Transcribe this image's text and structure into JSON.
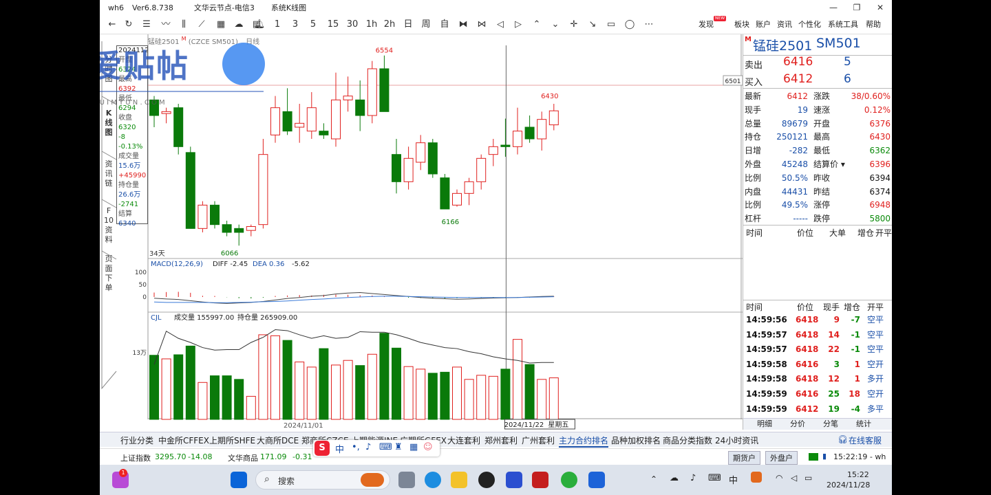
{
  "window": {
    "app": "wh6",
    "version": "Ver6.8.738",
    "server": "文华云节点-电信3",
    "view": "系统K线图"
  },
  "toolbar": {
    "periods": [
      "1",
      "3",
      "5",
      "15",
      "30",
      "1h",
      "2h",
      "日",
      "周",
      "自"
    ],
    "menu": [
      "发现",
      "板块",
      "账户",
      "资讯",
      "个性化",
      "系统工具",
      "帮助"
    ],
    "new_badge": "NEW"
  },
  "watermark": {
    "title": "我爱贴帖",
    "site": "W W W . Z U I M Y U N . C O M"
  },
  "left_tabs": [
    "分时图",
    "K线图",
    "资讯链",
    "F10资料",
    "页面下单"
  ],
  "chart_header": {
    "name": "锰硅2501",
    "code": "(CZCE SM501)",
    "period": "日线"
  },
  "info_panel": {
    "date": "20241122",
    "items": [
      {
        "label": "开盘",
        "value": "6324",
        "color": "green"
      },
      {
        "label": "最高",
        "value": "6392",
        "color": "red"
      },
      {
        "label": "最低",
        "value": "6294",
        "color": "green"
      },
      {
        "label": "收盘",
        "value": "6320",
        "color": "green"
      },
      {
        "label": "",
        "value": "-8",
        "color": "green"
      },
      {
        "label": "",
        "value": "-0.13%",
        "color": "green"
      },
      {
        "label": "成交量",
        "value": "15.6万",
        "color": "blue"
      },
      {
        "label": "",
        "value": "+45990",
        "color": "red"
      },
      {
        "label": "持仓量",
        "value": "26.6万",
        "color": "blue"
      },
      {
        "label": "",
        "value": "-2741",
        "color": "green"
      },
      {
        "label": "结算",
        "value": "6340",
        "color": "blue"
      }
    ]
  },
  "chart_data": {
    "type": "candlestick",
    "symbol": "锰硅2501",
    "candles": [
      {
        "o": 6440,
        "h": 6450,
        "l": 6370,
        "c": 6400
      },
      {
        "o": 6405,
        "h": 6420,
        "l": 6380,
        "c": 6410
      },
      {
        "o": 6420,
        "h": 6430,
        "l": 6300,
        "c": 6320
      },
      {
        "o": 6305,
        "h": 6320,
        "l": 6110,
        "c": 6110
      },
      {
        "o": 6110,
        "h": 6180,
        "l": 6100,
        "c": 6170
      },
      {
        "o": 6170,
        "h": 6180,
        "l": 6110,
        "c": 6120
      },
      {
        "o": 6120,
        "h": 6130,
        "l": 6090,
        "c": 6100
      },
      {
        "o": 6110,
        "h": 6120,
        "l": 6066,
        "c": 6100
      },
      {
        "o": 6105,
        "h": 6120,
        "l": 6090,
        "c": 6115
      },
      {
        "o": 6120,
        "h": 6340,
        "l": 6110,
        "c": 6300
      },
      {
        "o": 6350,
        "h": 6450,
        "l": 6330,
        "c": 6420
      },
      {
        "o": 6410,
        "h": 6470,
        "l": 6350,
        "c": 6360
      },
      {
        "o": 6370,
        "h": 6430,
        "l": 6330,
        "c": 6380
      },
      {
        "o": 6360,
        "h": 6460,
        "l": 6340,
        "c": 6420
      },
      {
        "o": 6360,
        "h": 6380,
        "l": 6340,
        "c": 6350
      },
      {
        "o": 6340,
        "h": 6510,
        "l": 6320,
        "c": 6440
      },
      {
        "o": 6440,
        "h": 6500,
        "l": 6410,
        "c": 6450
      },
      {
        "o": 6440,
        "h": 6490,
        "l": 6360,
        "c": 6400
      },
      {
        "o": 6400,
        "h": 6540,
        "l": 6380,
        "c": 6520
      },
      {
        "o": 6520,
        "h": 6554,
        "l": 6410,
        "c": 6410
      },
      {
        "o": 6300,
        "h": 6340,
        "l": 6200,
        "c": 6230
      },
      {
        "o": 6230,
        "h": 6320,
        "l": 6210,
        "c": 6290
      },
      {
        "o": 6280,
        "h": 6350,
        "l": 6260,
        "c": 6330
      },
      {
        "o": 6330,
        "h": 6340,
        "l": 6240,
        "c": 6250
      },
      {
        "o": 6240,
        "h": 6250,
        "l": 6160,
        "c": 6160
      },
      {
        "o": 6170,
        "h": 6210,
        "l": 6166,
        "c": 6200
      },
      {
        "o": 6200,
        "h": 6240,
        "l": 6170,
        "c": 6230
      },
      {
        "o": 6230,
        "h": 6300,
        "l": 6210,
        "c": 6290
      },
      {
        "o": 6300,
        "h": 6340,
        "l": 6270,
        "c": 6320
      },
      {
        "o": 6324,
        "h": 6392,
        "l": 6294,
        "c": 6320
      },
      {
        "o": 6320,
        "h": 6420,
        "l": 6300,
        "c": 6360
      },
      {
        "o": 6370,
        "h": 6400,
        "l": 6330,
        "c": 6340
      },
      {
        "o": 6340,
        "h": 6410,
        "l": 6310,
        "c": 6390
      },
      {
        "o": 6376,
        "h": 6430,
        "l": 6362,
        "c": 6412
      }
    ],
    "volumes": [
      12.5,
      11.8,
      12.6,
      14.3,
      7.2,
      8.5,
      8.5,
      7.8,
      4.5,
      16.5,
      16.3,
      15.4,
      11.2,
      10.2,
      13.8,
      10.6,
      11.5,
      10.5,
      12.7,
      16.8,
      13.9,
      10.3,
      9.8,
      9.0,
      9.2,
      10.2,
      7.8,
      8.6,
      8.4,
      9.8,
      15.6,
      10.7,
      7.8,
      8.1
    ],
    "volume_line": [
      10.7,
      17.2,
      15.8,
      15.0,
      14.0,
      13.5,
      13.6,
      13.6,
      15.0,
      16.0,
      17.5,
      17.3,
      16.5,
      15.8,
      16.3,
      15.8,
      16.0,
      17.1,
      17.0,
      17.0,
      16.5,
      15.8,
      15.0,
      14.5,
      14.0,
      13.8,
      13.2,
      12.8,
      12.2,
      11.8,
      11.5,
      11.0,
      11.1,
      11.1
    ],
    "macd_hist": [
      18,
      20,
      21,
      17,
      5,
      4,
      -1,
      -5,
      -6,
      -3,
      4,
      6,
      8,
      6,
      9,
      10,
      9,
      7,
      6,
      3,
      0,
      -3,
      -4,
      -6,
      -7,
      -5,
      -3,
      -3,
      -2,
      -2,
      -1,
      -3,
      1,
      2
    ],
    "diff_line": [
      -5,
      -8,
      -10,
      -15,
      -20,
      -24,
      -26,
      -24,
      -22,
      -18,
      -12,
      -6,
      -2,
      3,
      6,
      12,
      16,
      18,
      14,
      10,
      6,
      2,
      -2,
      -5,
      -7,
      -9,
      -8,
      -6,
      -4,
      -3,
      -2,
      0,
      2,
      3
    ],
    "dea_line": [
      -20,
      -22,
      -22,
      -22,
      -22,
      -23,
      -23,
      -22,
      -21,
      -19,
      -18,
      -16,
      -13,
      -10,
      -8,
      -5,
      -2,
      0,
      2,
      3,
      3,
      2,
      1,
      0,
      -1,
      -2,
      -2,
      -2,
      -2,
      -2,
      -2,
      -1,
      0,
      1
    ],
    "annotations": {
      "high": "6554",
      "low_left": "6066",
      "low_right": "6166",
      "recent_high": "6430",
      "current_line": "6501",
      "days": "34天"
    },
    "macd_header": {
      "label": "MACD(12,26,9)",
      "diff": "DIFF -2.45",
      "dea": "DEA 0.36",
      "macd": "-5.62"
    },
    "macd_ticks": [
      "100",
      "50",
      "0"
    ],
    "cjl_header": {
      "label": "CJL",
      "volume": "成交量 155997.00",
      "oi": "持仓量 265909.00"
    },
    "volume_tick": "13万",
    "x_labels": [
      "2024/11/01",
      "2024/11/22",
      "星期五"
    ],
    "price_range": [
      6040,
      6580
    ],
    "volume_max": 18.5
  },
  "quote": {
    "flag": "M",
    "name": "锰硅2501",
    "code": "SM501",
    "ask": {
      "label": "卖出",
      "price": "6416",
      "qty": "5"
    },
    "bid": {
      "label": "买入",
      "price": "6412",
      "qty": "6"
    },
    "rows": [
      {
        "l1": "最新",
        "v1": "6412",
        "c1": "red",
        "l2": "涨跌",
        "v2": "38/0.60%",
        "c2": "red"
      },
      {
        "l1": "现手",
        "v1": "19",
        "c1": "blue",
        "l2": "速涨",
        "v2": "0.12%",
        "c2": "red"
      },
      {
        "l1": "总量",
        "v1": "89679",
        "c1": "blue",
        "l2": "开盘",
        "v2": "6376",
        "c2": "red"
      },
      {
        "l1": "持仓",
        "v1": "250121",
        "c1": "blue",
        "l2": "最高",
        "v2": "6430",
        "c2": "red"
      },
      {
        "l1": "日增",
        "v1": "-282",
        "c1": "blue",
        "l2": "最低",
        "v2": "6362",
        "c2": "green"
      },
      {
        "l1": "外盘",
        "v1": "45248",
        "c1": "blue",
        "l2": "结算价",
        "v2": "6396",
        "c2": "red"
      },
      {
        "l1": "比例",
        "v1": "50.5%",
        "c1": "blue",
        "l2": "昨收",
        "v2": "6394",
        "c2": "dark"
      },
      {
        "l1": "内盘",
        "v1": "44431",
        "c1": "blue",
        "l2": "昨结",
        "v2": "6374",
        "c2": "dark"
      },
      {
        "l1": "比例",
        "v1": "49.5%",
        "c1": "blue",
        "l2": "涨停",
        "v2": "6948",
        "c2": "red"
      },
      {
        "l1": "杠杆",
        "v1": "-----",
        "c1": "blue",
        "l2": "跌停",
        "v2": "5800",
        "c2": "green"
      }
    ],
    "big_order_headers": [
      "时间",
      "价位",
      "大单",
      "增仓",
      "开平"
    ],
    "tick_headers": [
      "时间",
      "价位",
      "现手",
      "增仓",
      "开平"
    ],
    "ticks": [
      {
        "time": "14:59:56",
        "price": "6418",
        "qty": "9",
        "qc": "red",
        "oi": "-7",
        "oc": "green",
        "type": "空平"
      },
      {
        "time": "14:59:57",
        "price": "6418",
        "qty": "14",
        "qc": "red",
        "oi": "-1",
        "oc": "green",
        "type": "空平"
      },
      {
        "time": "14:59:57",
        "price": "6418",
        "qty": "22",
        "qc": "red",
        "oi": "-1",
        "oc": "green",
        "type": "空平"
      },
      {
        "time": "14:59:58",
        "price": "6416",
        "qty": "3",
        "qc": "green",
        "oi": "1",
        "oc": "red",
        "type": "空开"
      },
      {
        "time": "14:59:58",
        "price": "6418",
        "qty": "12",
        "qc": "red",
        "oi": "1",
        "oc": "red",
        "type": "多开"
      },
      {
        "time": "14:59:59",
        "price": "6416",
        "qty": "25",
        "qc": "green",
        "oi": "18",
        "oc": "red",
        "type": "空开"
      },
      {
        "time": "14:59:59",
        "price": "6412",
        "qty": "19",
        "qc": "green",
        "oi": "-4",
        "oc": "green",
        "type": "多平"
      }
    ],
    "subtabs": [
      "明细",
      "分价",
      "分笔",
      "统计"
    ]
  },
  "bottom_tabs": [
    "行业分类",
    "中金所CFFEX",
    "上期所SHFE",
    "大商所DCE",
    "郑商所CZCE",
    "上期能源INE",
    "广期所GFEX",
    "大连套利",
    "郑州套利",
    "广州套利",
    "主力合约排名",
    "品种加权排名",
    "商品分类指数",
    "24小时资讯"
  ],
  "service": "在线客服",
  "status": {
    "idx1_name": "上证指数",
    "idx1_val": "3295.70",
    "idx1_chg": "-14.08",
    "idx2_name": "文华商品",
    "idx2_val": "171.09",
    "idx2_chg": "-0.31",
    "futures_btn": "期货户",
    "fx_btn": "外盘户",
    "clock": "15:22:19 - wh"
  },
  "ime": {
    "lang": "中"
  },
  "taskbar": {
    "search": "搜索",
    "badge": "1",
    "time": "15:22",
    "date": "2024/11/28",
    "tray_lang": "中"
  },
  "colors": {
    "up": "#e0201e",
    "down": "#0a7a0a",
    "accent": "#1a4fa8"
  }
}
